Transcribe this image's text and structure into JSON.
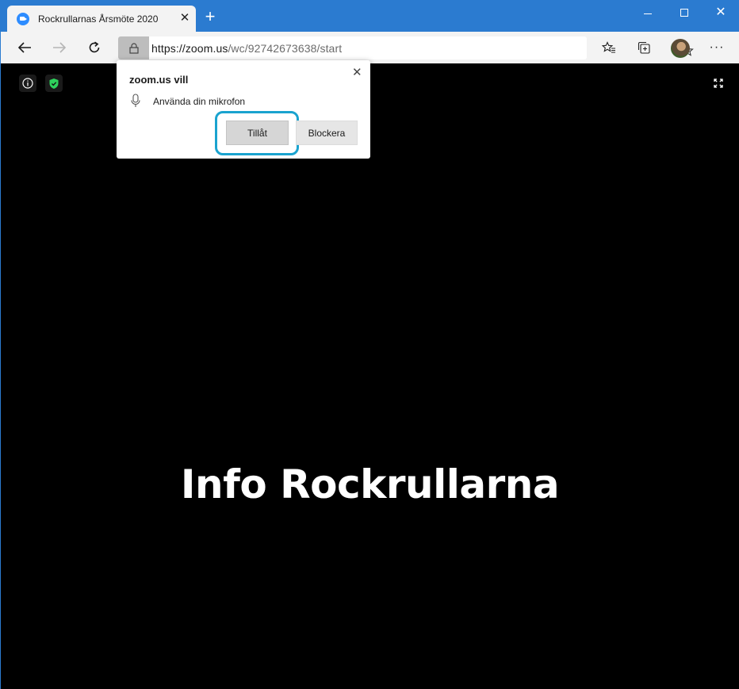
{
  "browser": {
    "tab_title": "Rockrullarnas Årsmöte 2020",
    "tab_close": "✕",
    "new_tab": "+",
    "url_host": "https://zoom.us",
    "url_path": "/wc/92742673638/start",
    "more_menu": "···"
  },
  "window_controls": {
    "close": "✕"
  },
  "permission_popup": {
    "title": "zoom.us vill",
    "close": "✕",
    "request": "Använda din mikrofon",
    "allow_label": "Tillåt",
    "block_label": "Blockera",
    "highlight_color": "#1aa3cf"
  },
  "meeting": {
    "title": "Info Rockrullarna",
    "shield_color": "#2ed15c"
  },
  "colors": {
    "titlebar": "#2b7bd0",
    "background": "#000000"
  },
  "icons": [
    "zoom-favicon-icon",
    "back-arrow-icon",
    "forward-arrow-icon",
    "reload-icon",
    "lock-icon",
    "star-icon",
    "favorites-icon",
    "collections-icon",
    "info-icon",
    "shield-check-icon",
    "fullscreen-icon",
    "microphone-icon"
  ]
}
